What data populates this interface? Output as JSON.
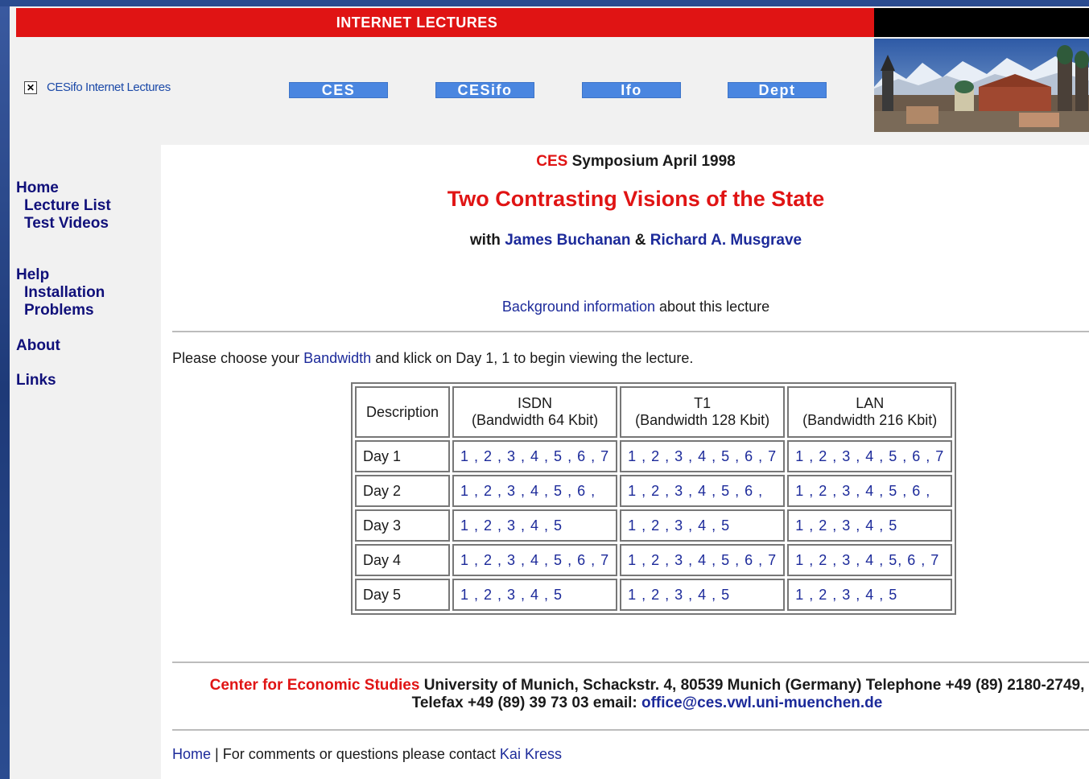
{
  "header": {
    "title": "INTERNET LECTURES",
    "logo_alt": "CESifo Internet Lectures"
  },
  "nav_buttons": [
    "CES",
    "CESifo",
    "Ifo",
    "Dept"
  ],
  "sidebar": {
    "home": "Home",
    "lecture_list": "Lecture List",
    "test_videos": "Test Videos",
    "help": "Help",
    "installation": "Installation",
    "problems": "Problems",
    "about": "About",
    "links": "Links"
  },
  "event": {
    "org": "CES",
    "symposium": "Symposium April 1998",
    "title": "Two Contrasting Visions of the State",
    "with_prefix": "with",
    "speaker1": "James Buchanan",
    "amp": "&",
    "speaker2": "Richard A. Musgrave",
    "bg_link": "Background information",
    "bg_rest": "about this lecture"
  },
  "instructions": {
    "prefix": "Please choose your",
    "link": "Bandwidth",
    "suffix": "and klick on Day 1, 1 to begin viewing the lecture."
  },
  "table": {
    "col_desc": "Description",
    "columns": [
      {
        "name": "ISDN",
        "bandwidth": "(Bandwidth 64 Kbit)"
      },
      {
        "name": "T1",
        "bandwidth": "(Bandwidth 128 Kbit)"
      },
      {
        "name": "LAN",
        "bandwidth": "(Bandwidth 216 Kbit)"
      }
    ],
    "rows": [
      {
        "label": "Day 1",
        "cells": [
          "1 , 2 , 3 , 4 , 5 , 6 , 7",
          "1 , 2 , 3 , 4 , 5 , 6 , 7",
          "1 , 2 , 3 , 4 , 5 , 6 , 7"
        ]
      },
      {
        "label": "Day 2",
        "cells": [
          "1 , 2 , 3 , 4 , 5 , 6 ,",
          "1 , 2 , 3 , 4 , 5 , 6 ,",
          "1 , 2 , 3 , 4 , 5 , 6 ,"
        ]
      },
      {
        "label": "Day 3",
        "cells": [
          "1 , 2 , 3 , 4 , 5",
          "1 , 2 , 3 , 4 , 5",
          "1 , 2 , 3 , 4 , 5"
        ]
      },
      {
        "label": "Day 4",
        "cells": [
          "1 , 2 , 3 , 4 , 5 , 6 , 7",
          "1 , 2 , 3 , 4 , 5 , 6 , 7",
          "1 , 2 , 3 , 4 , 5, 6 , 7"
        ]
      },
      {
        "label": "Day 5",
        "cells": [
          "1 , 2 , 3 , 4 , 5",
          "1 , 2 , 3 , 4 , 5",
          "1 , 2 , 3 , 4 , 5"
        ]
      }
    ]
  },
  "footer": {
    "org": "Center for Economic Studies",
    "address_line1": "University of Munich, Schackstr. 4, 80539 Munich (Germany) Telephone +49 (89) 2180-2749,",
    "address_line2_prefix": "Telefax +49 (89) 39 73 03 email:",
    "email": "office@ces.vwl.uni-muenchen.de",
    "home_link": "Home",
    "separator": "|",
    "contact_text": "For comments or questions please contact",
    "contact_name": "Kai Kress"
  },
  "colors": {
    "accent_red": "#e01414",
    "link_blue": "#1c2a9a",
    "nav_blue": "#4a86e0"
  }
}
